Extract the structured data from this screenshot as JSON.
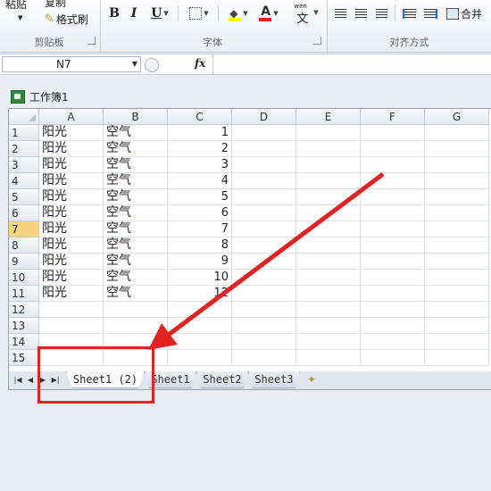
{
  "ribbon": {
    "clipboard": {
      "paste_label": "粘贴",
      "copy_label": "复制",
      "format_painter_label": "格式刷",
      "group_label": "剪贴板"
    },
    "font": {
      "bold": "B",
      "italic": "I",
      "underline": "U",
      "font_color_glyph": "A",
      "pinyin_top": "wén",
      "pinyin_glyph": "文",
      "group_label": "字体"
    },
    "alignment": {
      "merge_label": "合并",
      "group_label": "对齐方式"
    }
  },
  "formula_bar": {
    "name_box": "N7",
    "fx_label": "fx",
    "content": ""
  },
  "workbook": {
    "title": "工作簿1",
    "columns": [
      "A",
      "B",
      "C",
      "D",
      "E",
      "F",
      "G"
    ],
    "rows": [
      {
        "num": "1",
        "a": "阳光",
        "b": "空气",
        "c": "1"
      },
      {
        "num": "2",
        "a": "阳光",
        "b": "空气",
        "c": "2"
      },
      {
        "num": "3",
        "a": "阳光",
        "b": "空气",
        "c": "3"
      },
      {
        "num": "4",
        "a": "阳光",
        "b": "空气",
        "c": "4"
      },
      {
        "num": "5",
        "a": "阳光",
        "b": "空气",
        "c": "5"
      },
      {
        "num": "6",
        "a": "阳光",
        "b": "空气",
        "c": "6"
      },
      {
        "num": "7",
        "a": "阳光",
        "b": "空气",
        "c": "7"
      },
      {
        "num": "8",
        "a": "阳光",
        "b": "空气",
        "c": "8"
      },
      {
        "num": "9",
        "a": "阳光",
        "b": "空气",
        "c": "9"
      },
      {
        "num": "10",
        "a": "阳光",
        "b": "空气",
        "c": "10"
      },
      {
        "num": "11",
        "a": "阳光",
        "b": "空气",
        "c": "12"
      },
      {
        "num": "12",
        "a": "",
        "b": "",
        "c": ""
      },
      {
        "num": "13",
        "a": "",
        "b": "",
        "c": ""
      },
      {
        "num": "14",
        "a": "",
        "b": "",
        "c": ""
      },
      {
        "num": "15",
        "a": "",
        "b": "",
        "c": ""
      }
    ],
    "selected_row": "7",
    "tabs": [
      "Sheet1 (2)",
      "Sheet1",
      "Sheet2",
      "Sheet3"
    ],
    "active_tab": "Sheet1 (2)"
  },
  "colors": {
    "annotation_red": "#e32222",
    "selected_row_header": "#f8d37e"
  }
}
